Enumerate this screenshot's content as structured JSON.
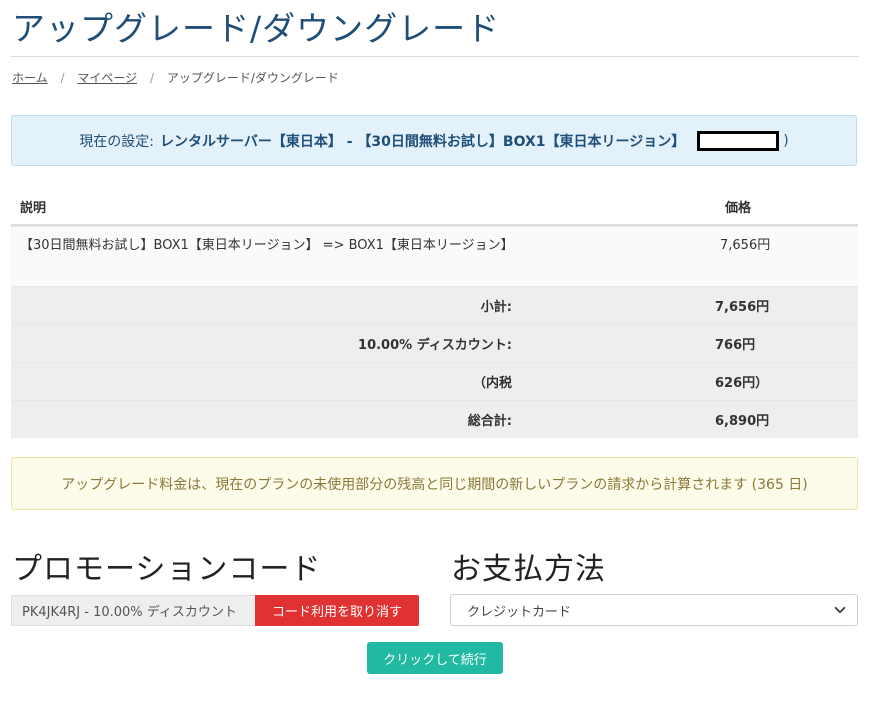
{
  "page": {
    "title": "アップグレード/ダウングレード"
  },
  "breadcrumb": {
    "home": "ホーム",
    "mypage": "マイページ",
    "current": "アップグレード/ダウングレード",
    "separator": "/"
  },
  "current_setting": {
    "label": "現在の設定:",
    "value": "レンタルサーバー【東日本】 - 【30日間無料お試し】BOX1【東日本リージョン】",
    "suffix": ")"
  },
  "table": {
    "headers": {
      "description": "説明",
      "price": "価格"
    },
    "item": {
      "description": "【30日間無料お試し】BOX1【東日本リージョン】 => BOX1【東日本リージョン】",
      "price": "7,656円"
    },
    "subtotal": {
      "label": "小計:",
      "value": "7,656円"
    },
    "discount": {
      "label": "10.00% ディスカウント:",
      "value": "766円"
    },
    "tax": {
      "label": "（内税",
      "value": "626円）"
    },
    "total": {
      "label": "総合計:",
      "value": "6,890円"
    }
  },
  "notice": {
    "text": "アップグレード料金は、現在のプランの未使用部分の残高と同じ期間の新しいプランの請求から計算されます (365 日)"
  },
  "promo": {
    "title": "プロモーションコード",
    "code_value": "PK4JK4RJ - 10.00% ディスカウント",
    "remove_button": "コード利用を取り消す"
  },
  "payment": {
    "title": "お支払方法",
    "selected": "クレジットカード"
  },
  "continue_button": "クリックして続行",
  "colors": {
    "title": "#1f4e79",
    "info_bg": "#e3f1fb",
    "warn_bg": "#fdfbe9",
    "danger": "#e03232",
    "primary": "#22b9a3"
  }
}
